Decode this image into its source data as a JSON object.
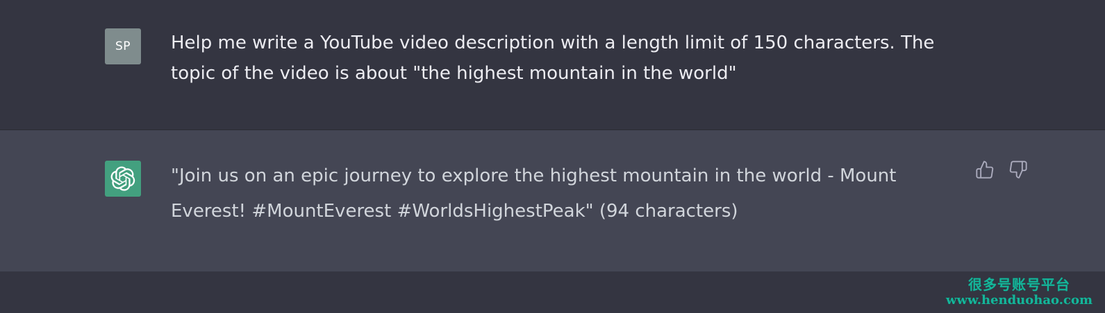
{
  "conversation": {
    "user": {
      "avatar_initials": "SP",
      "message": "Help me write a YouTube video description with a length limit of 150 characters. The topic of the video is about \"the highest mountain in the world\""
    },
    "assistant": {
      "avatar_icon": "openai-logo-icon",
      "message": "\"Join us on an epic journey to explore the highest mountain in the world - Mount Everest! #MountEverest #WorldsHighestPeak\" (94 characters)",
      "actions": {
        "thumbs_up_icon": "thumbs-up-icon",
        "thumbs_down_icon": "thumbs-down-icon"
      }
    }
  },
  "watermark": {
    "chinese_text": "很多号账号平台",
    "url": "www.henduohao.com"
  },
  "colors": {
    "background": "#343541",
    "assistant_background": "#444654",
    "user_avatar": "#7f8c8d",
    "assistant_avatar": "#43a07f",
    "watermark": "#15b59a"
  }
}
